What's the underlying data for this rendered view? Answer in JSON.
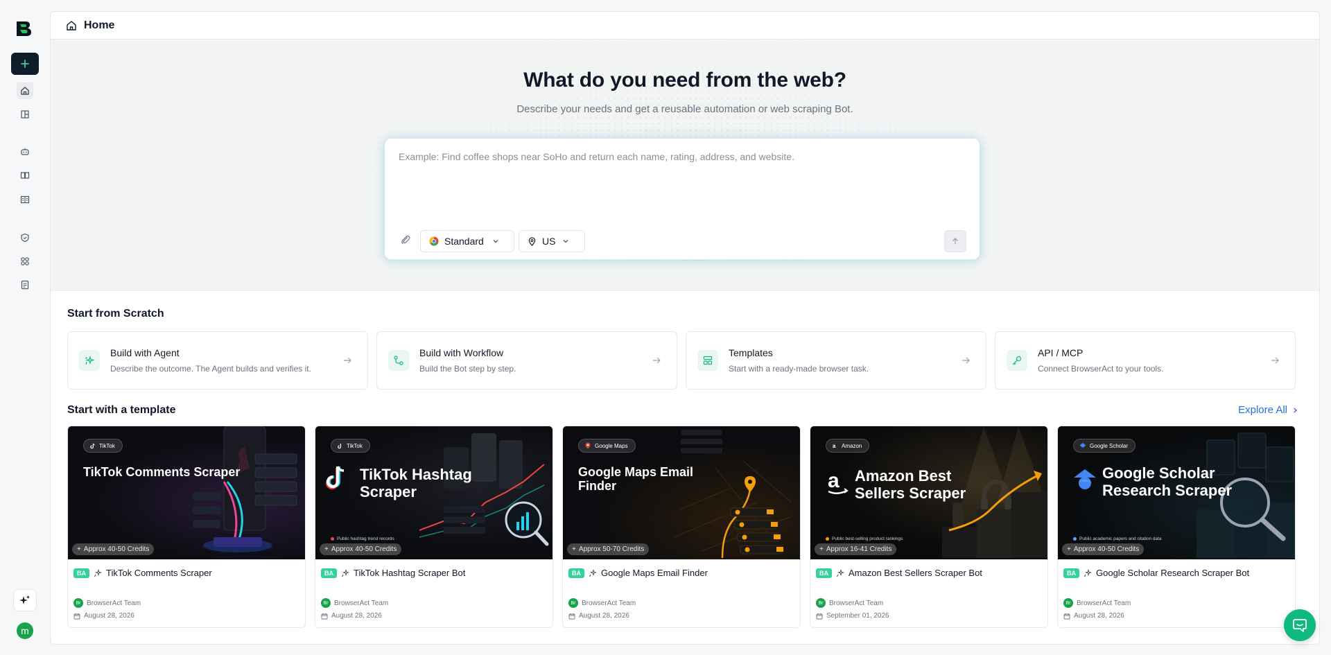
{
  "page": {
    "title": "Home"
  },
  "hero": {
    "heading": "What do you need from the web?",
    "subheading": "Describe your needs and get a reusable automation or web scraping Bot.",
    "placeholder": "Example: Find coffee shops near SoHo and return each name, rating, address, and website.",
    "value": "",
    "browser_mode": "Standard",
    "region": "US"
  },
  "sections": {
    "scratch_title": "Start from Scratch",
    "template_title": "Start with a template",
    "explore_all": "Explore All"
  },
  "scratch_cards": [
    {
      "title": "Build with Agent",
      "desc": "Describe the outcome. The Agent builds and verifies it.",
      "icon": "agent-sparkle-icon"
    },
    {
      "title": "Build with Workflow",
      "desc": "Build the Bot step by step.",
      "icon": "workflow-icon"
    },
    {
      "title": "Templates",
      "desc": "Start with a ready-made browser task.",
      "icon": "templates-icon"
    },
    {
      "title": "API / MCP",
      "desc": "Connect BrowserAct to your tools.",
      "icon": "key-icon"
    }
  ],
  "templates": [
    {
      "platform": "TikTok",
      "headline": "TikTok Comments Scraper",
      "credits": "Approx 40-50 Credits",
      "note": "",
      "badge": "BA",
      "name": "TikTok Comments Scraper",
      "author": "BrowserAct Team",
      "date": "August 28, 2026"
    },
    {
      "platform": "TikTok",
      "headline": "TikTok Hashtag Scraper",
      "credits": "Approx 40-50 Credits",
      "note": "Public hashtag trend records",
      "badge": "BA",
      "name": "TikTok Hashtag Scraper Bot",
      "author": "BrowserAct Team",
      "date": "August 28, 2026"
    },
    {
      "platform": "Google Maps",
      "headline": "Google Maps Email Finder",
      "credits": "Approx 50-70 Credits",
      "note": "",
      "badge": "BA",
      "name": "Google Maps Email Finder",
      "author": "BrowserAct Team",
      "date": "August 28, 2026"
    },
    {
      "platform": "Amazon",
      "headline": "Amazon Best Sellers Scraper",
      "credits": "Approx 16-41 Credits",
      "note": "Public best-selling product rankings",
      "badge": "BA",
      "name": "Amazon Best Sellers Scraper Bot",
      "author": "BrowserAct Team",
      "date": "September 01, 2026"
    },
    {
      "platform": "Google Scholar",
      "headline": "Google Scholar Research Scraper",
      "credits": "Approx 40-50 Credits",
      "note": "Public academic papers and citation data",
      "badge": "BA",
      "name": "Google Scholar Research Scraper Bot",
      "author": "BrowserAct Team",
      "date": "August 28, 2026"
    }
  ],
  "user": {
    "initial": "m",
    "author_initial": "Br"
  },
  "colors": {
    "brand": "#10b981",
    "dark": "#0f1d2b",
    "link": "#2b6fd6",
    "badge": "#34d399"
  }
}
